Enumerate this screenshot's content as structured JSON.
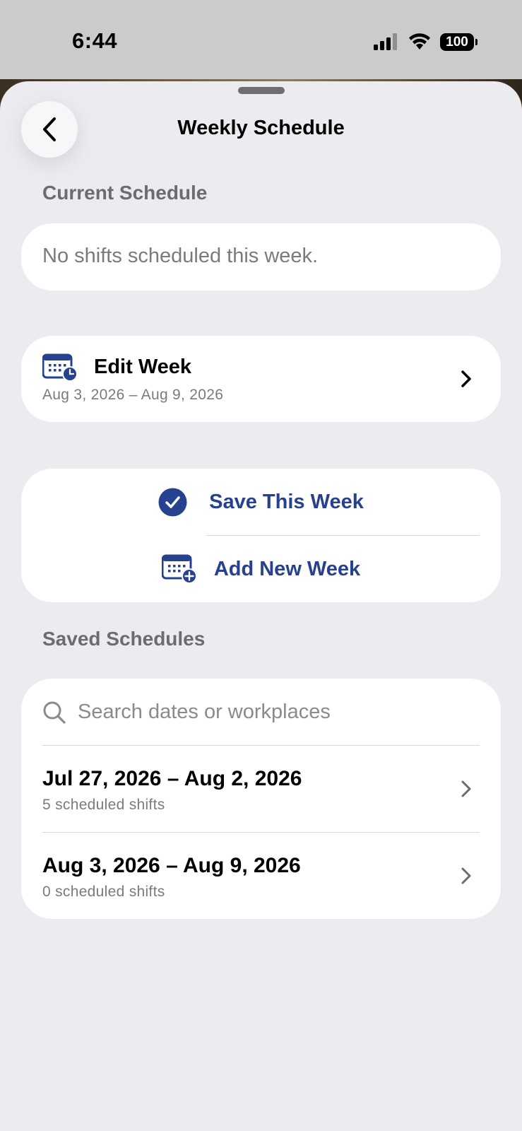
{
  "status_bar": {
    "time": "6:44",
    "battery_level": "100"
  },
  "header": {
    "title": "Weekly Schedule",
    "back_icon": "chevron-left-icon"
  },
  "current_schedule": {
    "label": "Current Schedule",
    "empty_message": "No shifts scheduled this week."
  },
  "edit_week": {
    "title": "Edit Week",
    "date_range": "Aug 3, 2026 – Aug 9, 2026",
    "icon": "calendar-clock-icon"
  },
  "actions": {
    "save_label": "Save This Week",
    "save_icon": "checkmark-circle-icon",
    "add_label": "Add New Week",
    "add_icon": "calendar-plus-icon"
  },
  "saved_schedules": {
    "label": "Saved Schedules",
    "search_placeholder": "Search dates or workplaces",
    "items": [
      {
        "date_range": "Jul 27, 2026 – Aug 2, 2026",
        "shifts": "5 scheduled shifts"
      },
      {
        "date_range": "Aug 3, 2026 – Aug 9, 2026",
        "shifts": "0 scheduled shifts"
      }
    ]
  },
  "colors": {
    "accent": "#25418f",
    "sheet_background": "#ebebf0",
    "card_background": "#ffffff",
    "secondary_text": "#7a7a7f"
  }
}
